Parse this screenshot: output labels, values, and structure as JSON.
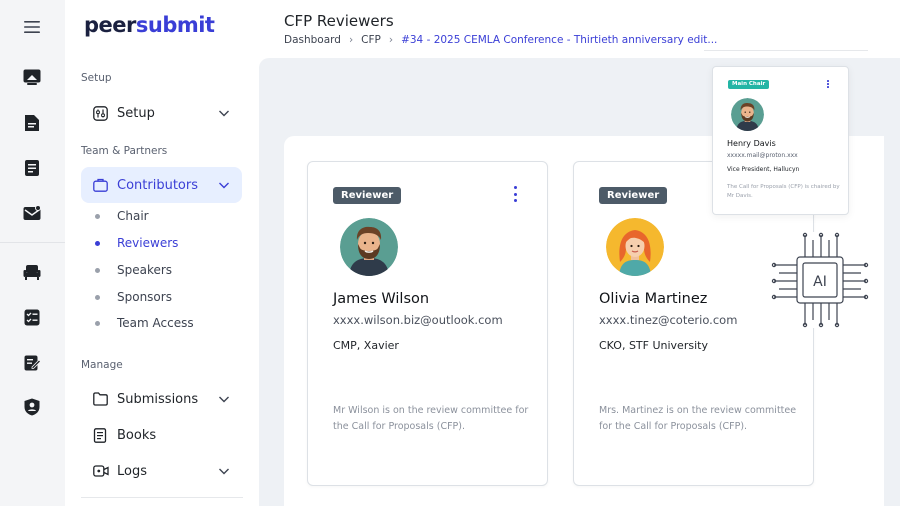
{
  "brand": {
    "logo_part1": "peer",
    "logo_part2": "submit"
  },
  "rail": {
    "icons": [
      "menu-icon",
      "presentation-icon",
      "document-icon",
      "notes-icon",
      "mail-icon",
      "chair-icon",
      "checklist-icon",
      "edit-list-icon",
      "shield-user-icon"
    ]
  },
  "sidebar": {
    "section_setup": "Setup",
    "setup_label": "Setup",
    "section_team": "Team & Partners",
    "contributors_label": "Contributors",
    "sub_items": [
      "Chair",
      "Reviewers",
      "Speakers",
      "Sponsors",
      "Team Access"
    ],
    "active_sub": "Reviewers",
    "section_manage": "Manage",
    "submissions_label": "Submissions",
    "books_label": "Books",
    "logs_label": "Logs"
  },
  "header": {
    "title": "CFP Reviewers",
    "breadcrumb": [
      "Dashboard",
      "CFP",
      "#34 - 2025 CEMLA Conference - Thirtieth anniversary edit..."
    ]
  },
  "cards": [
    {
      "badge": "Reviewer",
      "name": "James Wilson",
      "email": "xxxx.wilson.biz@outlook.com",
      "role": "CMP, Xavier",
      "description": "Mr Wilson is on the review committee for the Call for Proposals (CFP)."
    },
    {
      "badge": "Reviewer",
      "name": "Olivia Martinez",
      "email": "xxxx.tinez@coterio.com",
      "role": "CKO, STF University",
      "description": "Mrs. Martinez is on the review committee for the Call for Proposals (CFP)."
    }
  ],
  "chair_card": {
    "badge": "Main Chair",
    "name": "Henry Davis",
    "email": "xxxxx.mail@proton.xxx",
    "role": "Vice President, Hallucyn",
    "description": "The Call for Proposals (CFP) is chaired by Mr Davis."
  },
  "ai_label": "AI",
  "colors": {
    "accent": "#3a3ed6",
    "badge": "#4d5b68",
    "main_chair_badge": "#23b5a5",
    "active_bg": "#e7efff"
  }
}
